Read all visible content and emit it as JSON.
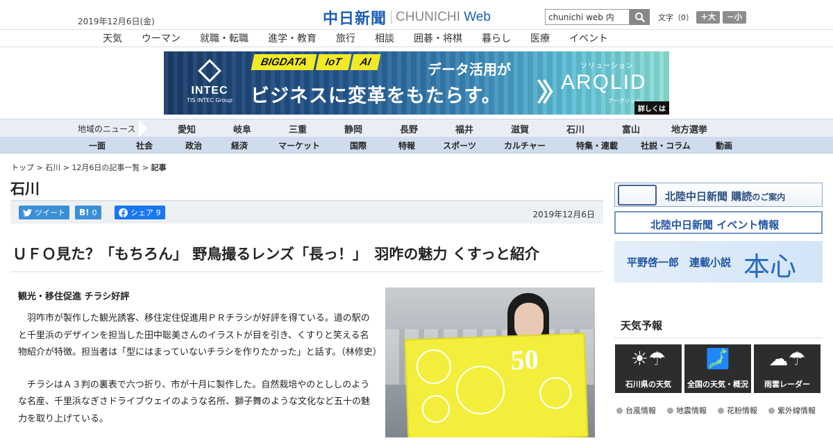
{
  "header": {
    "date": "2019年12月6日(金)",
    "logo_jp": "中日新聞",
    "logo_en_1": "CHUNICHI",
    "logo_en_2": "Web",
    "search_value": "chunichi web 内",
    "fontsize_label": "文字（0）",
    "font_up": "＋大",
    "font_down": "－小"
  },
  "nav_main": [
    "天気",
    "ウーマン",
    "就職・転職",
    "進学・教育",
    "旅行",
    "相談",
    "囲碁・将棋",
    "暮らし",
    "医療",
    "イベント"
  ],
  "banner": {
    "brand": "INTEC",
    "brand_sub": "TIS INTEC Group",
    "tags": [
      "BIGDATA",
      "IoT",
      "AI"
    ],
    "copy1": "データ活用が",
    "copy2": "ビジネスに変革をもたらす。",
    "solution": "ソリューション",
    "product": "ARQLID",
    "product_kana": "アークリッド",
    "more": "詳しくは"
  },
  "nav_region": {
    "label": "地域のニュース",
    "items": [
      "愛知",
      "岐阜",
      "三重",
      "静岡",
      "長野",
      "福井",
      "滋賀",
      "石川",
      "富山",
      "地方選挙"
    ]
  },
  "nav_sections": [
    "一面",
    "社会",
    "政治",
    "経済",
    "マーケット",
    "国際",
    "特報",
    "スポーツ",
    "カルチャー",
    "特集・連載",
    "社説・コラム",
    "動画"
  ],
  "breadcrumb": {
    "top": "トップ",
    "sep": " > ",
    "region": "石川",
    "list": "12月6日の記事一覧",
    "current": "記事"
  },
  "section_title": "石川",
  "share": {
    "tweet": "ツイート",
    "hatena_count": "0",
    "fb_label": "シェア",
    "fb_count": "9",
    "date": "2019年12月6日"
  },
  "article": {
    "headline": "ＵＦＯ見た？「もちろん」 野鳥撮るレンズ「長っ！」　羽咋の魅力 くすっと紹介",
    "lede": "観光・移住促進 チラシ好評",
    "paragraphs": [
      "羽咋市が製作した観光誘客、移住定住促進用ＰＲチラシが好評を得ている。道の駅のと千里浜のデザインを担当した田中聡美さんのイラストが目を引き、くすりと笑える名物紹介が特徴。担当者は「型にはまっていないチラシを作りたかった」と話す。（林修史）",
      "チラシはＡ３判の裏表で六つ折り、市が十月に製作した。自然栽培やのとししのような名産、千里浜なぎさドライブウェイのような名所、獅子舞のような文化など五十の魅力を取り上げている。"
    ],
    "photo_text": "50"
  },
  "sidebar": {
    "ad1": "北陸中日新聞 購読",
    "ad1_small": "のご案内",
    "ad2": "北陸中日新聞 イベント情報",
    "ad3_a": "平野啓一郎　連載小説",
    "ad3_b": "本心",
    "weather_title": "天気予報",
    "tiles": [
      "石川県の天気",
      "全国の天気・概況",
      "雨雲レーダー"
    ],
    "links": [
      "台風情報",
      "地震情報",
      "花粉情報",
      "紫外線情報"
    ]
  }
}
